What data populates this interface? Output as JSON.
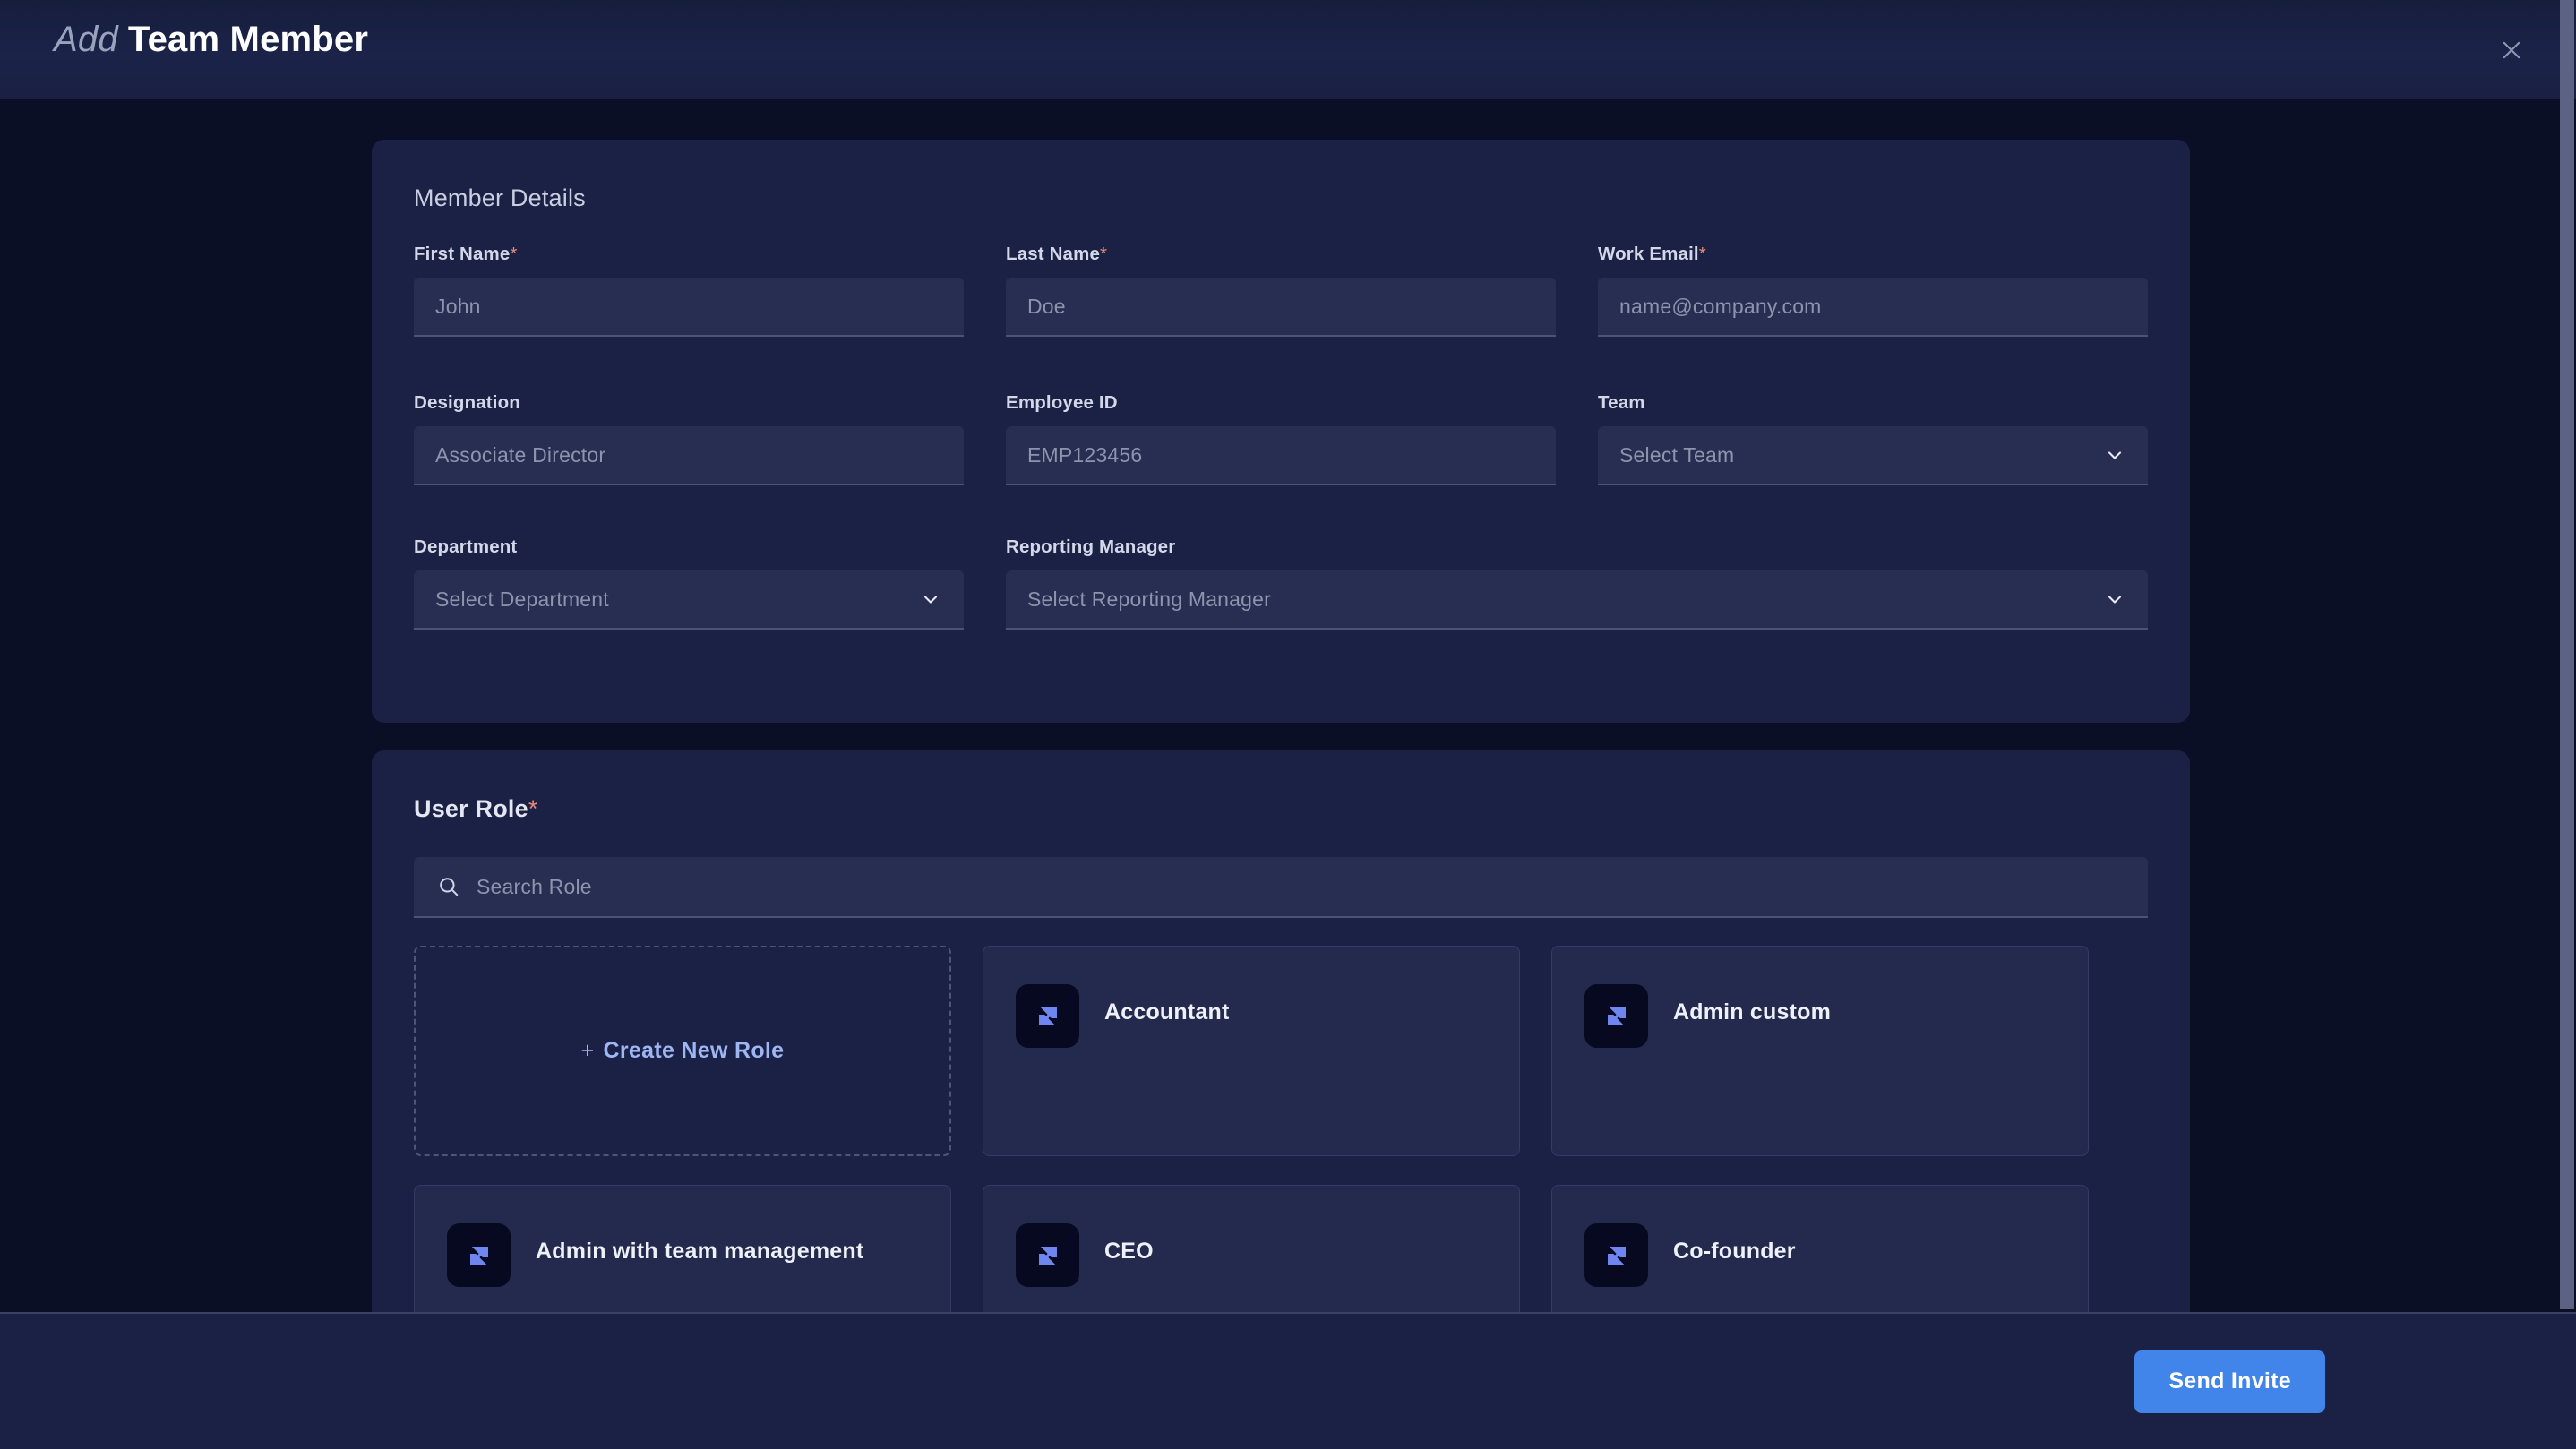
{
  "header": {
    "title_light": "Add",
    "title_bold": "Team Member",
    "close_icon": "close-icon"
  },
  "member_details": {
    "heading": "Member Details",
    "fields": [
      {
        "label": "First Name",
        "required": true,
        "placeholder": "John",
        "type": "text",
        "icon": ""
      },
      {
        "label": "Last Name",
        "required": true,
        "placeholder": "Doe",
        "type": "text",
        "icon": ""
      },
      {
        "label": "Work Email",
        "required": true,
        "placeholder": "name@company.com",
        "type": "text",
        "icon": ""
      },
      {
        "label": "Designation",
        "required": false,
        "placeholder": "Associate Director",
        "type": "text",
        "icon": ""
      },
      {
        "label": "Employee ID",
        "required": false,
        "placeholder": "EMP123456",
        "type": "text",
        "icon": ""
      },
      {
        "label": "Team",
        "required": false,
        "placeholder": "Select Team",
        "type": "select",
        "icon": "chevron-down-icon"
      },
      {
        "label": "Department",
        "required": false,
        "placeholder": "Select Department",
        "type": "select",
        "icon": "chevron-down-icon"
      },
      {
        "label": "Reporting Manager",
        "required": false,
        "placeholder": "Select Reporting Manager",
        "type": "select",
        "icon": "chevron-down-icon"
      }
    ]
  },
  "user_role": {
    "heading": "User Role",
    "required": true,
    "search": {
      "placeholder": "Search Role",
      "value": "",
      "icon": "search-icon"
    },
    "create_card": {
      "plus": "+",
      "label": "Create New Role"
    },
    "roles": [
      {
        "name": "Accountant",
        "icon": "role-badge-icon"
      },
      {
        "name": "Admin custom",
        "icon": "role-badge-icon"
      },
      {
        "name": "Admin with team management",
        "icon": "role-badge-icon"
      },
      {
        "name": "CEO",
        "icon": "role-badge-icon"
      },
      {
        "name": "Co-founder",
        "icon": "role-badge-icon"
      }
    ]
  },
  "footer": {
    "send_label": "Send Invite"
  },
  "colors": {
    "page_bg": "#0a0f26",
    "panel_bg": "#1a2145",
    "header_bg": "#192043",
    "input_bg": "#272e52",
    "accent_blue": "#4285ea",
    "role_icon_blue": "#6f86f0",
    "required_star": "#e98a74",
    "create_role_text": "#9fb6f5",
    "scrollbar_thumb": "#5b6283"
  }
}
